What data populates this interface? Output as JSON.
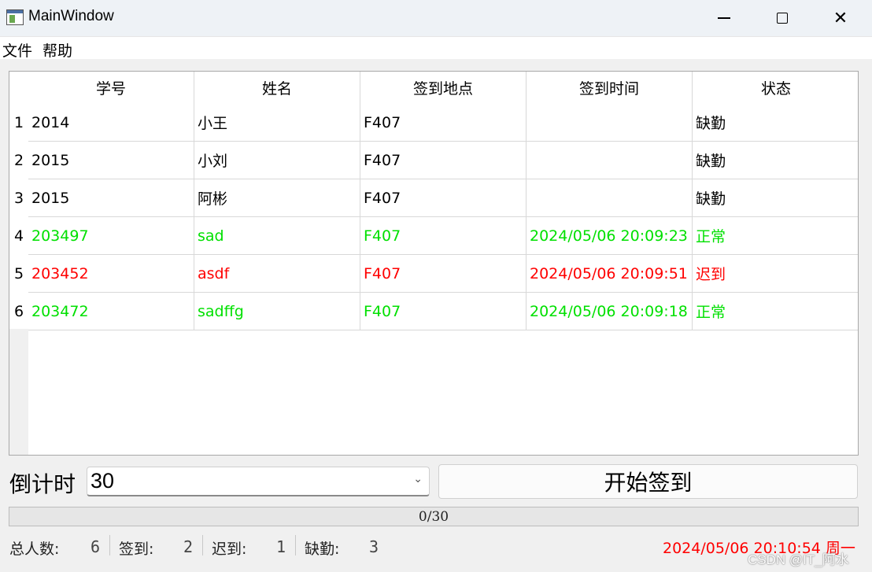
{
  "window": {
    "title": "MainWindow",
    "minimize_icon": "minimize-icon",
    "maximize_icon": "maximize-icon",
    "close_icon": "close-icon",
    "close_glyph": "✕"
  },
  "menu": {
    "items": [
      {
        "label": "文件"
      },
      {
        "label": "帮助"
      }
    ]
  },
  "table": {
    "columns": [
      "学号",
      "姓名",
      "签到地点",
      "签到时间",
      "状态"
    ],
    "rows": [
      {
        "num": "1",
        "color": "#000000",
        "cells": [
          "2014",
          "小王",
          "F407",
          "",
          "缺勤"
        ]
      },
      {
        "num": "2",
        "color": "#000000",
        "cells": [
          "2015",
          "小刘",
          "F407",
          "",
          "缺勤"
        ]
      },
      {
        "num": "3",
        "color": "#000000",
        "cells": [
          "2015",
          "阿彬",
          "F407",
          "",
          "缺勤"
        ]
      },
      {
        "num": "4",
        "color": "#00e000",
        "cells": [
          "203497",
          "sad",
          "F407",
          "2024/05/06 20:09:23",
          "正常"
        ]
      },
      {
        "num": "5",
        "color": "#ff0000",
        "cells": [
          "203452",
          "asdf",
          "F407",
          "2024/05/06 20:09:51",
          "迟到"
        ]
      },
      {
        "num": "6",
        "color": "#00e000",
        "cells": [
          "203472",
          "sadffg",
          "F407",
          "2024/05/06 20:09:18",
          "正常"
        ]
      }
    ]
  },
  "controls": {
    "countdown_label": "倒计时",
    "countdown_value": "30",
    "dropdown_icon": "chevron-down-icon",
    "dropdown_glyph": "⌄",
    "start_button": "开始签到"
  },
  "progress": {
    "text": "0/30",
    "value": 0,
    "max": 30
  },
  "stats": {
    "total_label": "总人数:",
    "total_value": "6",
    "signed_label": "签到:",
    "signed_value": "2",
    "late_label": "迟到:",
    "late_value": "1",
    "absent_label": "缺勤:",
    "absent_value": "3"
  },
  "clock": {
    "text": "2024/05/06 20:10:54 周一"
  },
  "watermark": {
    "text": "CSDN @IT_阿水"
  }
}
